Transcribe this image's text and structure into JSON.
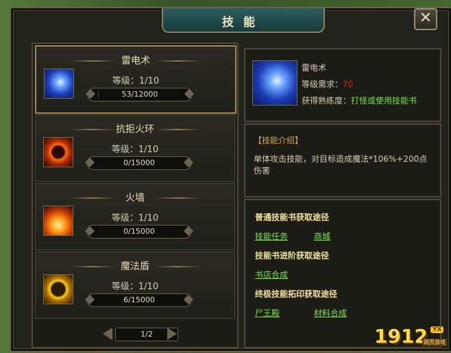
{
  "window": {
    "title": "技能",
    "close_glyph": "✕"
  },
  "skills": [
    {
      "name": "雷电术",
      "level": "等级：1/10",
      "progress_text": "53/12000",
      "progress_fraction": 0.0044,
      "icon": "lightning-icon",
      "selected": true
    },
    {
      "name": "抗拒火环",
      "level": "等级：1/10",
      "progress_text": "0/15000",
      "progress_fraction": 0,
      "icon": "fire-ring-icon",
      "selected": false
    },
    {
      "name": "火墙",
      "level": "等级：1/10",
      "progress_text": "0/15000",
      "progress_fraction": 0,
      "icon": "fire-wall-icon",
      "selected": false
    },
    {
      "name": "魔法盾",
      "level": "等级：1/10",
      "progress_text": "6/15000",
      "progress_fraction": 0.0004,
      "icon": "magic-shield-icon",
      "selected": false
    }
  ],
  "pager": {
    "text": "1/2"
  },
  "detail": {
    "name": "雷电术",
    "req_label": "等级需求：",
    "req_value": "70",
    "gain_label": "获得熟练度：",
    "gain_value": "打怪或使用技能书"
  },
  "intro": {
    "title": "【技能介绍】",
    "body": "单体攻击技能，对目标造成魔法*106%+200点伤害"
  },
  "paths": {
    "normal_title": "普通技能书获取途径",
    "normal_links": [
      "技能任务",
      "商城"
    ],
    "advanced_title": "技能书进阶获取途径",
    "advanced_links": [
      "书店合成"
    ],
    "ultimate_title": "终极技能拓印获取途径",
    "ultimate_links": [
      "尸王殿",
      "材料合成"
    ]
  },
  "watermark": {
    "number": "1912",
    "yx": "YX",
    "sub": "网页游戏"
  },
  "colors": {
    "accent_green": "#7be24b",
    "req_red": "#e21818",
    "frame": "#6d6450"
  }
}
